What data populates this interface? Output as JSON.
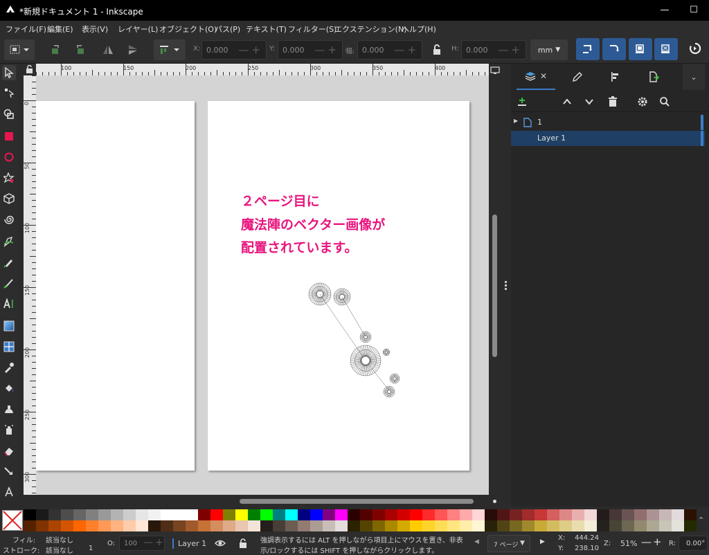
{
  "window": {
    "title": "*新規ドキュメント 1 - Inkscape",
    "minimize": "—",
    "maximize": "☐"
  },
  "menu": [
    {
      "label": "ファイル(F)"
    },
    {
      "label": "編集(E)"
    },
    {
      "label": "表示(V)"
    },
    {
      "label": "レイヤー(L)"
    },
    {
      "label": "オブジェクト(O)"
    },
    {
      "label": "パス(P)"
    },
    {
      "label": "テキスト(T)"
    },
    {
      "label": "フィルター(S)"
    },
    {
      "label": "エクステンション(N)"
    },
    {
      "label": "ヘルプ(H)"
    }
  ],
  "toolbar": {
    "x_label": "X:",
    "x_value": "0.000",
    "y_label": "Y:",
    "y_value": "0.000",
    "w_label": "幅:",
    "w_value": "0.000",
    "h_label": "H:",
    "h_value": "0.000",
    "unit": "mm"
  },
  "ruler": {
    "h_ticks": [
      "100",
      "150",
      "200",
      "250",
      "300",
      "350",
      "400"
    ],
    "v_ticks": [
      "0",
      "50",
      "100",
      "150",
      "200",
      "250",
      "300"
    ]
  },
  "canvas": {
    "annotation_lines": [
      "２ページ目に",
      "魔法陣のベクター画像が",
      "配置されています。"
    ]
  },
  "layers_panel": {
    "rows": [
      {
        "label": "1",
        "selected": false
      },
      {
        "label": "Layer 1",
        "selected": true
      }
    ]
  },
  "palette": {
    "colors": [
      "#000000",
      "#1a1a1a",
      "#333333",
      "#4d4d4d",
      "#666666",
      "#808080",
      "#999999",
      "#b3b3b3",
      "#cccccc",
      "#e6e6e6",
      "#f2f2f2",
      "#ffffff",
      "#ffffff",
      "#ffffff",
      "#800000",
      "#ff0000",
      "#808000",
      "#ffff00",
      "#008000",
      "#00ff00",
      "#008080",
      "#00ffff",
      "#000080",
      "#0000ff",
      "#800080",
      "#ff00ff",
      "#2b0000",
      "#550000",
      "#800000",
      "#aa0000",
      "#d40000",
      "#ff0000",
      "#ff2a2a",
      "#ff5555",
      "#ff8080",
      "#ffaaaa",
      "#ffd5d5",
      "#280b0b",
      "#501616",
      "#782121",
      "#a02c2c",
      "#c83737",
      "#d35f5f",
      "#de8787",
      "#e9afaf",
      "#f4d7d7",
      "#241c1c",
      "#483737",
      "#6c5353",
      "#916f6f",
      "#ac9393",
      "#c8b7b7",
      "#e3dbdb",
      "#2b1100"
    ],
    "colors2": [
      "#552200",
      "#803300",
      "#aa4400",
      "#d45500",
      "#ff6600",
      "#ff7f2a",
      "#ff9955",
      "#ffb380",
      "#ffccaa",
      "#ffe6d5",
      "#28170b",
      "#502d16",
      "#784421",
      "#a05a2c",
      "#c87137",
      "#d38d5f",
      "#deaa87",
      "#e9c6af",
      "#f4e3d7",
      "#241f1c",
      "#483e37",
      "#6c5d53",
      "#917c6f",
      "#ac9d93",
      "#c8beb7",
      "#e3dedb",
      "#2b2200",
      "#554400",
      "#806600",
      "#aa8800",
      "#d4aa00",
      "#ffcc00",
      "#ffd42a",
      "#ffdd55",
      "#ffe680",
      "#ffeeaa",
      "#fff6d5",
      "#28220b",
      "#504416",
      "#786721",
      "#a0892c",
      "#c8ab37",
      "#d3bc5f",
      "#decd87",
      "#e9ddaf",
      "#f4eed7",
      "#24221c",
      "#484537",
      "#6c6753",
      "#918a6f",
      "#aca793",
      "#c8c4b7",
      "#e3e2db",
      "#222b00"
    ]
  },
  "status": {
    "fill_label": "フィル:",
    "fill_value": "該当なし",
    "stroke_label": "ストローク:",
    "stroke_value": "該当なし",
    "stroke_width": "1",
    "opacity_label": "O:",
    "opacity_value": "100",
    "layer": "Layer 1",
    "message_1": "強調表示するには ALT を押しながら項目上にマウスを置き、非表",
    "message_2": "示/ロックするには SHIFT を押しながらクリックします。",
    "page_select": "7 ページ",
    "x_label": "X:",
    "x_value": "444.24",
    "y_label": "Y:",
    "y_value": "238.10",
    "zoom_label": "Z:",
    "zoom_value": "51%",
    "rotation_label": "R:",
    "rotation_value": "0.00°"
  }
}
